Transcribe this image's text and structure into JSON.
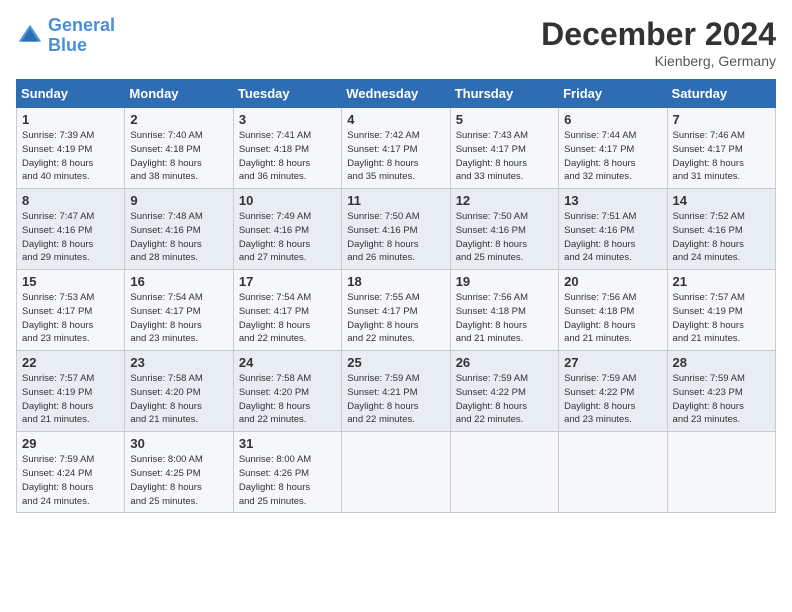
{
  "header": {
    "logo_line1": "General",
    "logo_line2": "Blue",
    "month": "December 2024",
    "location": "Kienberg, Germany"
  },
  "weekdays": [
    "Sunday",
    "Monday",
    "Tuesday",
    "Wednesday",
    "Thursday",
    "Friday",
    "Saturday"
  ],
  "weeks": [
    [
      {
        "day": "1",
        "info": "Sunrise: 7:39 AM\nSunset: 4:19 PM\nDaylight: 8 hours\nand 40 minutes."
      },
      {
        "day": "2",
        "info": "Sunrise: 7:40 AM\nSunset: 4:18 PM\nDaylight: 8 hours\nand 38 minutes."
      },
      {
        "day": "3",
        "info": "Sunrise: 7:41 AM\nSunset: 4:18 PM\nDaylight: 8 hours\nand 36 minutes."
      },
      {
        "day": "4",
        "info": "Sunrise: 7:42 AM\nSunset: 4:17 PM\nDaylight: 8 hours\nand 35 minutes."
      },
      {
        "day": "5",
        "info": "Sunrise: 7:43 AM\nSunset: 4:17 PM\nDaylight: 8 hours\nand 33 minutes."
      },
      {
        "day": "6",
        "info": "Sunrise: 7:44 AM\nSunset: 4:17 PM\nDaylight: 8 hours\nand 32 minutes."
      },
      {
        "day": "7",
        "info": "Sunrise: 7:46 AM\nSunset: 4:17 PM\nDaylight: 8 hours\nand 31 minutes."
      }
    ],
    [
      {
        "day": "8",
        "info": "Sunrise: 7:47 AM\nSunset: 4:16 PM\nDaylight: 8 hours\nand 29 minutes."
      },
      {
        "day": "9",
        "info": "Sunrise: 7:48 AM\nSunset: 4:16 PM\nDaylight: 8 hours\nand 28 minutes."
      },
      {
        "day": "10",
        "info": "Sunrise: 7:49 AM\nSunset: 4:16 PM\nDaylight: 8 hours\nand 27 minutes."
      },
      {
        "day": "11",
        "info": "Sunrise: 7:50 AM\nSunset: 4:16 PM\nDaylight: 8 hours\nand 26 minutes."
      },
      {
        "day": "12",
        "info": "Sunrise: 7:50 AM\nSunset: 4:16 PM\nDaylight: 8 hours\nand 25 minutes."
      },
      {
        "day": "13",
        "info": "Sunrise: 7:51 AM\nSunset: 4:16 PM\nDaylight: 8 hours\nand 24 minutes."
      },
      {
        "day": "14",
        "info": "Sunrise: 7:52 AM\nSunset: 4:16 PM\nDaylight: 8 hours\nand 24 minutes."
      }
    ],
    [
      {
        "day": "15",
        "info": "Sunrise: 7:53 AM\nSunset: 4:17 PM\nDaylight: 8 hours\nand 23 minutes."
      },
      {
        "day": "16",
        "info": "Sunrise: 7:54 AM\nSunset: 4:17 PM\nDaylight: 8 hours\nand 23 minutes."
      },
      {
        "day": "17",
        "info": "Sunrise: 7:54 AM\nSunset: 4:17 PM\nDaylight: 8 hours\nand 22 minutes."
      },
      {
        "day": "18",
        "info": "Sunrise: 7:55 AM\nSunset: 4:17 PM\nDaylight: 8 hours\nand 22 minutes."
      },
      {
        "day": "19",
        "info": "Sunrise: 7:56 AM\nSunset: 4:18 PM\nDaylight: 8 hours\nand 21 minutes."
      },
      {
        "day": "20",
        "info": "Sunrise: 7:56 AM\nSunset: 4:18 PM\nDaylight: 8 hours\nand 21 minutes."
      },
      {
        "day": "21",
        "info": "Sunrise: 7:57 AM\nSunset: 4:19 PM\nDaylight: 8 hours\nand 21 minutes."
      }
    ],
    [
      {
        "day": "22",
        "info": "Sunrise: 7:57 AM\nSunset: 4:19 PM\nDaylight: 8 hours\nand 21 minutes."
      },
      {
        "day": "23",
        "info": "Sunrise: 7:58 AM\nSunset: 4:20 PM\nDaylight: 8 hours\nand 21 minutes."
      },
      {
        "day": "24",
        "info": "Sunrise: 7:58 AM\nSunset: 4:20 PM\nDaylight: 8 hours\nand 22 minutes."
      },
      {
        "day": "25",
        "info": "Sunrise: 7:59 AM\nSunset: 4:21 PM\nDaylight: 8 hours\nand 22 minutes."
      },
      {
        "day": "26",
        "info": "Sunrise: 7:59 AM\nSunset: 4:22 PM\nDaylight: 8 hours\nand 22 minutes."
      },
      {
        "day": "27",
        "info": "Sunrise: 7:59 AM\nSunset: 4:22 PM\nDaylight: 8 hours\nand 23 minutes."
      },
      {
        "day": "28",
        "info": "Sunrise: 7:59 AM\nSunset: 4:23 PM\nDaylight: 8 hours\nand 23 minutes."
      }
    ],
    [
      {
        "day": "29",
        "info": "Sunrise: 7:59 AM\nSunset: 4:24 PM\nDaylight: 8 hours\nand 24 minutes."
      },
      {
        "day": "30",
        "info": "Sunrise: 8:00 AM\nSunset: 4:25 PM\nDaylight: 8 hours\nand 25 minutes."
      },
      {
        "day": "31",
        "info": "Sunrise: 8:00 AM\nSunset: 4:26 PM\nDaylight: 8 hours\nand 25 minutes."
      },
      null,
      null,
      null,
      null
    ]
  ]
}
